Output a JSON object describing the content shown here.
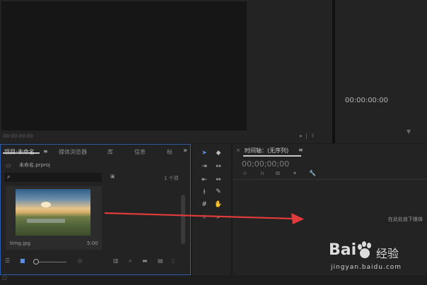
{
  "source_monitor": {
    "timecode": "00:00:00:00"
  },
  "program_monitor": {
    "timecode": "00:00:00:00"
  },
  "project_panel": {
    "tabs": [
      {
        "label": "项目:未命名"
      },
      {
        "label": "媒体浏览器"
      },
      {
        "label": "库"
      },
      {
        "label": "信息"
      },
      {
        "label": "标"
      }
    ],
    "menu_glyph": "≡",
    "more_glyph": "»",
    "file_name": "未命名.prproj",
    "search": {
      "placeholder": ""
    },
    "item_count": "1 个项",
    "items": [
      {
        "name": "timg.jpg",
        "duration": "5:00"
      }
    ]
  },
  "timeline_panel": {
    "title": "时间轴：(无序列)",
    "menu_glyph": "≡",
    "timecode": "00;00;00;00",
    "drop_hint": "在此处放下媒体"
  },
  "watermark": {
    "logo": "Bai",
    "brand": "经验",
    "url": "jingyan.baidu.com"
  },
  "colors": {
    "accent": "#2f5dae",
    "arrow": "#e23b3b",
    "selected_icon": "#5b8fe8"
  }
}
